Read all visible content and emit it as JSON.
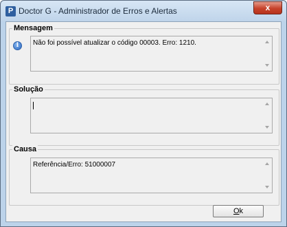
{
  "window": {
    "title": "Doctor G - Administrador de Erros e Alertas",
    "app_icon_glyph": "P",
    "close_glyph": "x"
  },
  "groups": {
    "mensagem": {
      "label": "Mensagem",
      "text": "Não foi possível atualizar o código 00003. Erro: 1210.",
      "icon": "info-icon",
      "icon_glyph": "i"
    },
    "solucao": {
      "label": "Solução",
      "text": ""
    },
    "causa": {
      "label": "Causa",
      "text": "Referência/Erro: 51000007"
    }
  },
  "buttons": {
    "ok_first": "O",
    "ok_rest": "k"
  },
  "colors": {
    "accent": "#2f6cc1",
    "close": "#c6422a"
  }
}
